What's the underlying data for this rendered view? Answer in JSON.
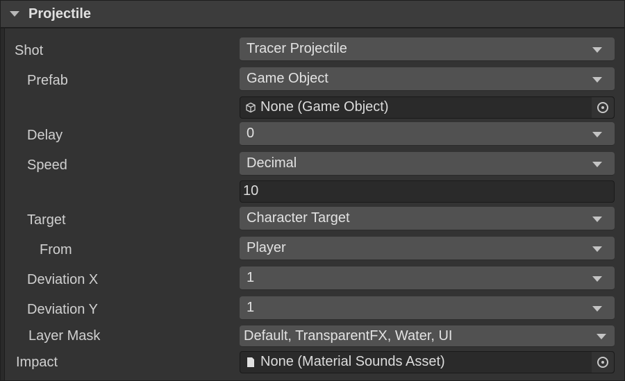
{
  "header": {
    "title": "Projectile"
  },
  "fields": {
    "shot": {
      "label": "Shot",
      "value": "Tracer Projectile"
    },
    "prefab": {
      "label": "Prefab",
      "value": "Game Object",
      "object_value": "None (Game Object)",
      "object_icon": "cube-icon"
    },
    "delay": {
      "label": "Delay",
      "value": "0"
    },
    "speed": {
      "label": "Speed",
      "value": "Decimal",
      "number_value": "10"
    },
    "target": {
      "label": "Target",
      "value": "Character Target"
    },
    "from": {
      "label": "From",
      "value": "Player"
    },
    "deviation_x": {
      "label": "Deviation X",
      "value": "1"
    },
    "deviation_y": {
      "label": "Deviation Y",
      "value": "1"
    },
    "layer_mask": {
      "label": "Layer Mask",
      "value": "Default, TransparentFX, Water, UI"
    },
    "impact": {
      "label": "Impact",
      "value": "None (Material Sounds Asset)",
      "object_icon": "file-icon"
    }
  }
}
